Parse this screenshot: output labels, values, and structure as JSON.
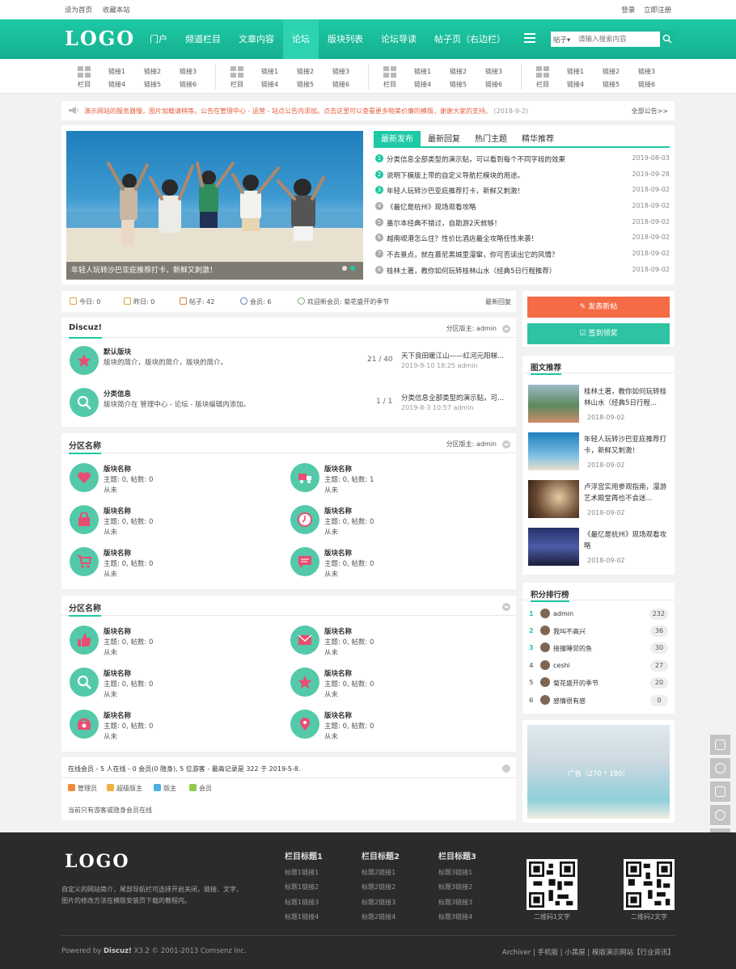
{
  "topbar": {
    "left": [
      "设为首页",
      "收藏本站"
    ],
    "right": [
      "登录",
      "立即注册"
    ]
  },
  "nav": {
    "logo": "LOGO",
    "items": [
      "门户",
      "频道栏目",
      "文章内容",
      "论坛",
      "版块列表",
      "论坛导读",
      "帖子页（右边栏）"
    ],
    "active_index": 3,
    "search_select": "帖子",
    "search_placeholder": "请输入搜索内容"
  },
  "quicklinks": [
    {
      "cat": "栏目",
      "links": [
        "链接1",
        "链接2",
        "链接3",
        "链接4",
        "链接5",
        "链接6"
      ]
    },
    {
      "cat": "栏目",
      "links": [
        "链接1",
        "链接2",
        "链接3",
        "链接4",
        "链接5",
        "链接6"
      ]
    },
    {
      "cat": "栏目",
      "links": [
        "链接1",
        "链接2",
        "链接3",
        "链接4",
        "链接5",
        "链接6"
      ]
    },
    {
      "cat": "栏目",
      "links": [
        "链接1",
        "链接2",
        "链接3",
        "链接4",
        "链接5",
        "链接6"
      ]
    }
  ],
  "notice": {
    "text": "演示网站的服务器慢，图片加载请稍等。公告在管理中心 - 运营 - 站点公告内添加。点击这里可以查看更多物美价廉的模版，谢谢大家的支持。",
    "date": "(2018-9-2)",
    "more": "全部公告>>"
  },
  "slider": {
    "caption": "年轻人玩转沙巴亚庇推荐打卡，新鲜又刺激！"
  },
  "news": {
    "tabs": [
      "最新发布",
      "最新回复",
      "热门主题",
      "精华推荐"
    ],
    "items": [
      {
        "n": "1",
        "title": "分类信息全部类型的演示贴，可以看到每个不同字段的效果",
        "date": "2019-08-03"
      },
      {
        "n": "2",
        "title": "说明下模版上带的自定义导航栏模块的用途。",
        "date": "2019-09-28"
      },
      {
        "n": "3",
        "title": "年轻人玩转沙巴亚庇推荐打卡，新鲜又刺激！",
        "date": "2018-09-02"
      },
      {
        "n": "4",
        "title": "《最忆是杭州》现场观看攻略",
        "date": "2018-09-02"
      },
      {
        "n": "5",
        "title": "墨尔本经典不错过，自助游2天就够！",
        "date": "2018-09-02"
      },
      {
        "n": "6",
        "title": "越南岘港怎么住？性价比酒店最全攻略任性来袭！",
        "date": "2018-09-02"
      },
      {
        "n": "7",
        "title": "不去景点，就在慕尼黑城里漫窜，你可否读出它的风情？",
        "date": "2018-09-02"
      },
      {
        "n": "8",
        "title": "桂林土著，教你如何玩转桂林山水（经典5日行程推荐）",
        "date": "2018-09-02"
      }
    ]
  },
  "stats": {
    "today": "今日: 0",
    "yesterday": "昨日: 0",
    "posts": "帖子: 42",
    "members": "会员: 6",
    "welcome": "欢迎新会员: 菊花盛开的季节",
    "latest": "最新回复"
  },
  "discuz": {
    "title": "Discuz!",
    "moderator": "分区版主: admin",
    "forums": [
      {
        "name": "默认版块",
        "desc": "版块的简介，版块的简介，版块的简介。",
        "count": "21 / 40",
        "last": "天下良田暖江山——红河元阳梯...",
        "time": "2019-9-10 18:25 admin"
      },
      {
        "name": "分类信息",
        "desc": "版块简介在 管理中心 - 论坛 - 版块编辑内添加。",
        "count": "1 / 1",
        "last": "分类信息全部类型的演示贴，可...",
        "time": "2019-8-3 10:57 admin"
      }
    ]
  },
  "zone1": {
    "title": "分区名称",
    "moderator": "分区版主: admin",
    "forums": [
      {
        "name": "版块名称",
        "stat": "主题: 0, 帖数: 0",
        "last": "从未"
      },
      {
        "name": "版块名称",
        "stat": "主题: 0, 帖数: 1",
        "last": "从未"
      },
      {
        "name": "版块名称",
        "stat": "主题: 0, 帖数: 0",
        "last": "从未"
      },
      {
        "name": "版块名称",
        "stat": "主题: 0, 帖数: 0",
        "last": "从未"
      },
      {
        "name": "版块名称",
        "stat": "主题: 0, 帖数: 0",
        "last": "从未"
      },
      {
        "name": "版块名称",
        "stat": "主题: 0, 帖数: 0",
        "last": "从未"
      }
    ]
  },
  "zone2": {
    "title": "分区名称",
    "forums": [
      {
        "name": "版块名称",
        "stat": "主题: 0, 帖数: 0",
        "last": "从未"
      },
      {
        "name": "版块名称",
        "stat": "主题: 0, 帖数: 0",
        "last": "从未"
      },
      {
        "name": "版块名称",
        "stat": "主题: 0, 帖数: 0",
        "last": "从未"
      },
      {
        "name": "版块名称",
        "stat": "主题: 0, 帖数: 0",
        "last": "从未"
      },
      {
        "name": "版块名称",
        "stat": "主题: 0, 帖数: 0",
        "last": "从未"
      },
      {
        "name": "版块名称",
        "stat": "主题: 0, 帖数: 0",
        "last": "从未"
      }
    ]
  },
  "online": {
    "summary": "在线会员 - 5 人在线 - 0 会员(0 隐身), 5 位游客 - 最高记录是 322 于 2019-5-8.",
    "legend": [
      "管理员",
      "超级版主",
      "版主",
      "会员"
    ],
    "note": "当前只有游客或隐身会员在线"
  },
  "sidebar": {
    "post_btn": "发表新帖",
    "sign_btn": "签到领奖",
    "pic_title": "图文推荐",
    "pics": [
      {
        "title": "桂林土著，教你如何玩转桂林山水（经典5日行程...",
        "date": "2018-09-02"
      },
      {
        "title": "年轻人玩转沙巴亚庇推荐打卡，新鲜又刺激！",
        "date": "2018-09-02"
      },
      {
        "title": "卢浮宫实用参观指南，漫游艺术殿堂再也不会迷...",
        "date": "2018-09-02"
      },
      {
        "title": "《最忆是杭州》现场观看攻略",
        "date": "2018-09-02"
      }
    ],
    "rank_title": "积分排行榜",
    "rank": [
      {
        "n": "1",
        "name": "admin",
        "score": "232"
      },
      {
        "n": "2",
        "name": "我叫不高兴",
        "score": "36"
      },
      {
        "n": "3",
        "name": "接撞睡觉的鱼",
        "score": "30"
      },
      {
        "n": "4",
        "name": "ceshi",
        "score": "27"
      },
      {
        "n": "5",
        "name": "菊花盛开的季节",
        "score": "20"
      },
      {
        "n": "6",
        "name": "感情很有感",
        "score": "0"
      }
    ],
    "ad_label": "广告（270 * 180）"
  },
  "footer": {
    "logo": "LOGO",
    "desc": "自定义的网站简介，尾部导航栏可选择开启关闭，链接、文字、图片的修改方法在模版安装页下载的教程内。",
    "cols": [
      {
        "title": "栏目标题1",
        "links": [
          "标题1链接1",
          "标题1链接2",
          "标题1链接3",
          "标题1链接4"
        ]
      },
      {
        "title": "栏目标题2",
        "links": [
          "标题2链接1",
          "标题2链接2",
          "标题2链接3",
          "标题2链接4"
        ]
      },
      {
        "title": "栏目标题3",
        "links": [
          "标题3链接1",
          "标题3链接2",
          "标题3链接3",
          "标题3链接4"
        ]
      }
    ],
    "qr1": "二维码1文字",
    "qr2": "二维码2文字",
    "powered_prefix": "Powered by ",
    "powered_brand": "Discuz!",
    "powered_rest": " X3.2 © 2001-2013 Comsenz Inc.",
    "links": "Archiver | 手机版 | 小黑屋 | 模版演示网站【行业资讯】"
  },
  "colors": {
    "accent": "#1ec9a5",
    "post_button": "#f56b45",
    "sign_button": "#2ec4a3",
    "footer_bg": "#2b2b2b"
  }
}
